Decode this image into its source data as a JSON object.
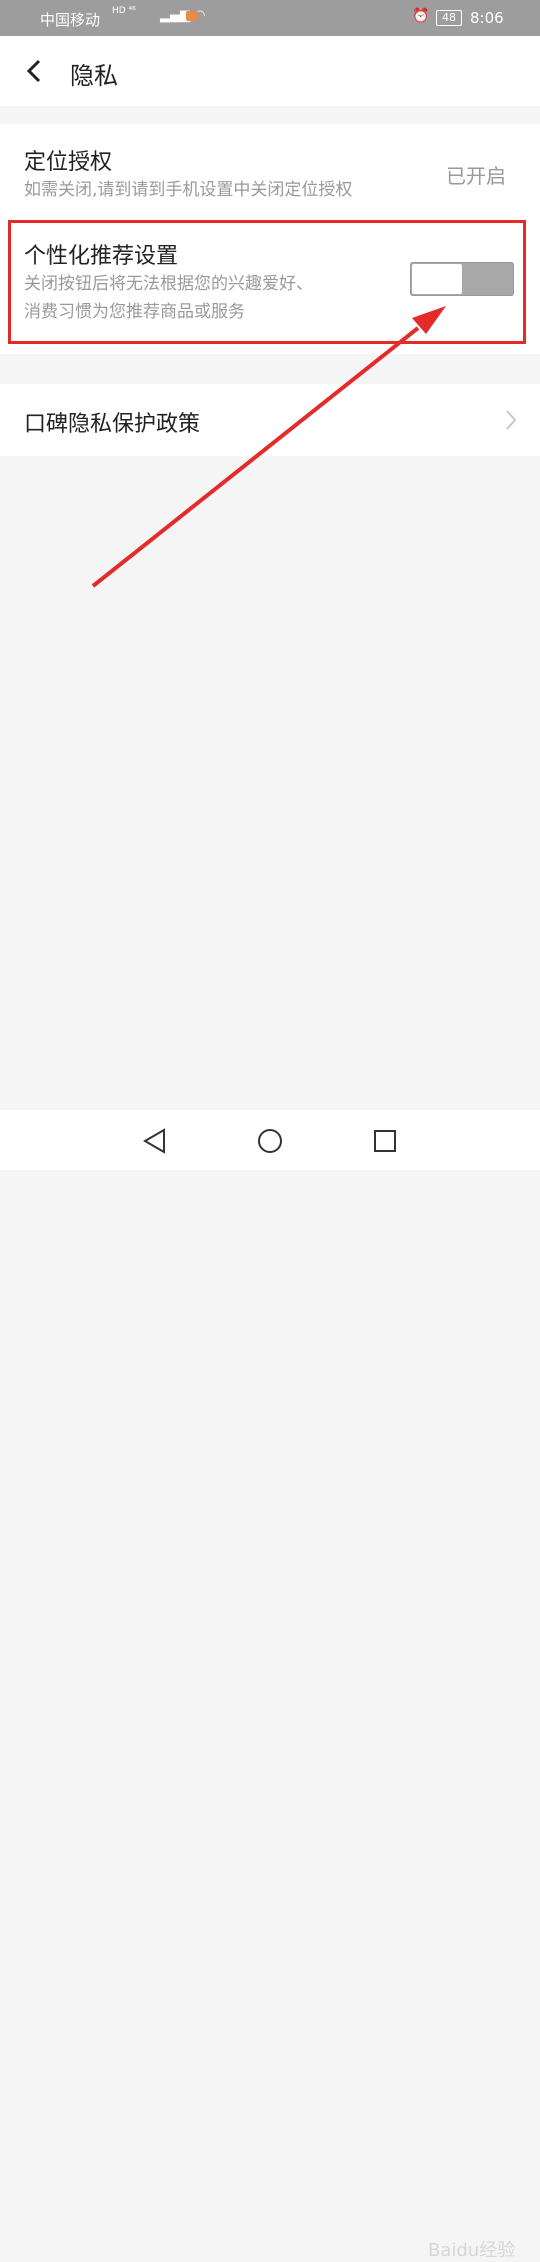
{
  "status": {
    "carrier": "中国移动",
    "network": "HD ⁴⁶",
    "battery": "48",
    "time": "8:06"
  },
  "header": {
    "title": "隐私"
  },
  "location": {
    "title": "定位授权",
    "desc": "如需关闭,请到请到手机设置中关闭定位授权",
    "value": "已开启"
  },
  "personalized": {
    "title": "个性化推荐设置",
    "desc_line1": "关闭按钮后将无法根据您的兴趣爱好、",
    "desc_line2": "消费习惯为您推荐商品或服务",
    "toggle_on": false
  },
  "policy": {
    "title": "口碑隐私保护政策"
  },
  "watermark": "Baidu经验",
  "colors": {
    "highlight": "#e52a2a",
    "toggle_off": "#a8a8a8",
    "background": "#f5f5f5"
  }
}
